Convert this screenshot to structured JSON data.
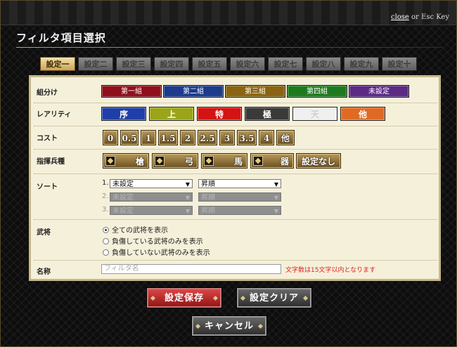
{
  "header": {
    "close_link": "close",
    "close_suffix": " or Esc Key",
    "title": "フィルタ項目選択"
  },
  "tabs": [
    "設定一",
    "設定二",
    "設定三",
    "設定四",
    "設定五",
    "設定六",
    "設定七",
    "設定八",
    "設定九",
    "設定十"
  ],
  "active_tab": "設定一",
  "labels": {
    "group": "組分け",
    "rarity": "レアリティ",
    "cost": "コスト",
    "unit": "指揮兵種",
    "sort": "ソート",
    "general": "武将",
    "name": "名称"
  },
  "groups": [
    {
      "label": "第一組",
      "color": "#8f0f1c"
    },
    {
      "label": "第二組",
      "color": "#1c3b8c"
    },
    {
      "label": "第三組",
      "color": "#8a6412"
    },
    {
      "label": "第四組",
      "color": "#1f7a1f"
    },
    {
      "label": "未設定",
      "color": "#5c2a86"
    }
  ],
  "rarities": [
    {
      "label": "序",
      "bg": "#1f3fa8",
      "fg": "#ffffff"
    },
    {
      "label": "上",
      "bg": "#9aa51a",
      "fg": "#ffffff"
    },
    {
      "label": "特",
      "bg": "#d41313",
      "fg": "#ffffff"
    },
    {
      "label": "極",
      "bg": "#3a3a3a",
      "fg": "#ffffff"
    },
    {
      "label": "天",
      "bg": "#f0f0f0",
      "fg": "#cfcfcf"
    },
    {
      "label": "他",
      "bg": "#e06a24",
      "fg": "#ffffff"
    }
  ],
  "costs": [
    "0",
    "0.5",
    "1",
    "1.5",
    "2",
    "2.5",
    "3",
    "3.5",
    "4",
    "他"
  ],
  "units": [
    "槍",
    "弓",
    "馬",
    "器",
    "設定なし"
  ],
  "sort": {
    "rows": [
      {
        "num": "1.",
        "key": "未設定",
        "order": "昇順",
        "enabled": true
      },
      {
        "num": "2.",
        "key": "未設定",
        "order": "昇順",
        "enabled": false
      },
      {
        "num": "3.",
        "key": "未設定",
        "order": "昇順",
        "enabled": false
      }
    ],
    "arrow": "▼"
  },
  "generals": {
    "options": [
      "全ての武将を表示",
      "負傷している武将のみを表示",
      "負傷していない武将のみを表示"
    ],
    "selected_index": 0
  },
  "name": {
    "placeholder": "フィルタ名",
    "note": "文字数は15文字以内となります"
  },
  "buttons": {
    "save": "設定保存",
    "clear": "設定クリア",
    "cancel": "キャンセル"
  }
}
